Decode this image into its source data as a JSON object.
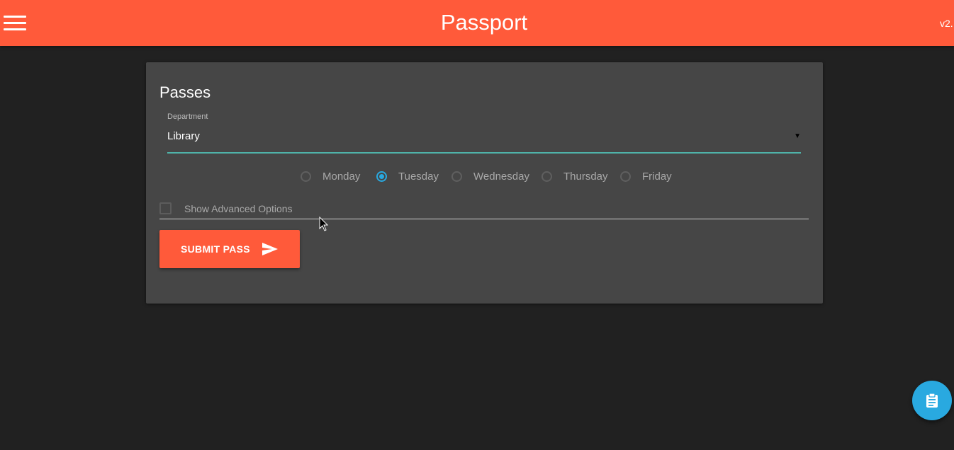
{
  "header": {
    "title": "Passport",
    "version": "v2.",
    "menu_icon": "hamburger-menu-icon",
    "background_color": "#ff5a3a"
  },
  "card": {
    "title": "Passes",
    "department": {
      "label": "Department",
      "value": "Library"
    },
    "days": [
      {
        "label": "Monday",
        "checked": false
      },
      {
        "label": "Tuesday",
        "checked": true
      },
      {
        "label": "Wednesday",
        "checked": false
      },
      {
        "label": "Thursday",
        "checked": false
      },
      {
        "label": "Friday",
        "checked": false
      }
    ],
    "advanced_options": {
      "label": "Show Advanced Options",
      "checked": false
    },
    "submit": {
      "label": "SUBMIT PASS",
      "icon": "send-icon"
    }
  },
  "fab": {
    "icon": "clipboard-icon",
    "color": "#29a9e0"
  },
  "colors": {
    "accent": "#ff5a3a",
    "selected": "#29a9e0",
    "underline": "#4fb3a9",
    "background": "#212121",
    "card": "#464646"
  }
}
